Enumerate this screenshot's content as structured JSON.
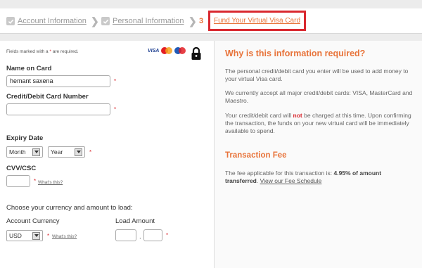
{
  "steps": {
    "step1": "Account Information",
    "step2": "Personal Information",
    "step3_number": "3",
    "step3": "Fund Your Virtual Visa Card",
    "accent": "#e8743b",
    "highlight": "#d9282f"
  },
  "form": {
    "required_note_pre": "Fields marked with a ",
    "required_star": "*",
    "required_note_post": " are required.",
    "card_logos": [
      "visa-logo",
      "mastercard-logo",
      "maestro-logo"
    ],
    "visa_text": "VISA",
    "name_label": "Name on Card",
    "name_value": "hemant  saxena",
    "card_number_label": "Credit/Debit Card Number",
    "card_number_value": "",
    "expiry_label": "Expiry Date",
    "month_value": "Month",
    "year_value": "Year",
    "cvv_label": "CVV/CSC",
    "cvv_value": "",
    "whats_this": "What's this?",
    "currency_heading": "Choose your currency and amount to load:",
    "currency_label": "Account Currency",
    "currency_value": "USD",
    "amount_label": "Load Amount",
    "amount_whole": "",
    "amount_sep": ".",
    "amount_cents": "",
    "star": "*"
  },
  "info": {
    "title": "Why is this information required?",
    "p1": "The personal credit/debit card you enter will be used to add money to your virtual Visa card.",
    "p2": "We currently accept all major credit/debit cards: VISA, MasterCard and Maestro.",
    "p3_pre": "Your credit/debit card will ",
    "p3_not": "not",
    "p3_post": " be charged at this time. Upon confirming the transaction, the funds on your new virtual card will be immediately available to spend.",
    "fee_title": "Transaction Fee",
    "fee_pre": "The fee applicable for this transaction is: ",
    "fee_bold": "4.95% of amount transferred",
    "fee_post": ". ",
    "fee_link": "View our Fee Schedule"
  }
}
